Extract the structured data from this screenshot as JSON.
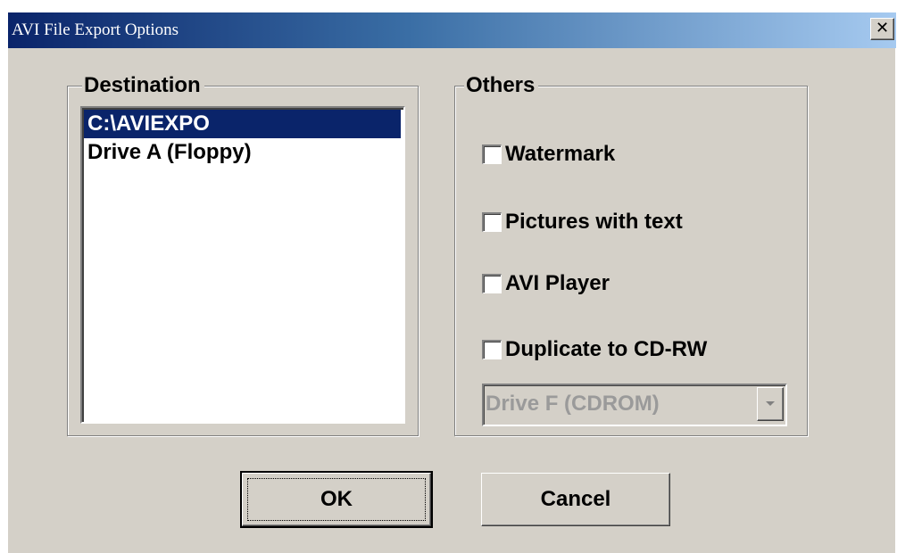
{
  "window": {
    "title": "AVI File Export Options",
    "close_glyph": "✕"
  },
  "destination": {
    "label": "Destination",
    "items": [
      {
        "label": "C:\\AVIEXPO",
        "selected": true
      },
      {
        "label": "Drive A (Floppy)",
        "selected": false
      }
    ]
  },
  "others": {
    "label": "Others",
    "checkboxes": [
      {
        "label": "Watermark",
        "checked": false
      },
      {
        "label": "Pictures with text",
        "checked": false
      },
      {
        "label": "AVI Player",
        "checked": false
      },
      {
        "label": "Duplicate to CD-RW",
        "checked": false
      }
    ],
    "drive_select": {
      "value": "Drive F (CDROM)",
      "enabled": false
    }
  },
  "buttons": {
    "ok": "OK",
    "cancel": "Cancel"
  },
  "colors": {
    "face": "#d4d0c8",
    "selection": "#0a246a",
    "title_start": "#0a246a",
    "title_end": "#a6caf0",
    "disabled_text": "#9a9a9a"
  },
  "icons": {
    "close": "close-icon",
    "dropdown": "chevron-down-icon"
  }
}
